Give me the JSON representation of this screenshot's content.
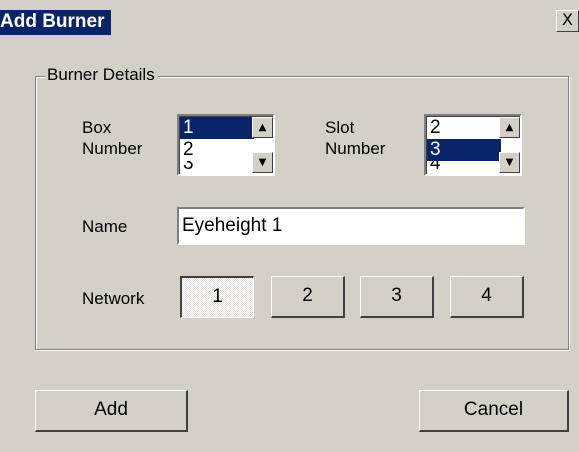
{
  "window": {
    "title": "Add Burner",
    "close_label": "X"
  },
  "group": {
    "label": "Burner Details"
  },
  "box_number": {
    "label_line1": "Box",
    "label_line2": "Number",
    "items": [
      "1",
      "2"
    ],
    "selected": "1"
  },
  "slot_number": {
    "label_line1": "Slot",
    "label_line2": "Number",
    "items": [
      "2",
      "3"
    ],
    "selected": "3"
  },
  "name": {
    "label": "Name",
    "value": "Eyeheight 1"
  },
  "network": {
    "label": "Network",
    "buttons": [
      "1",
      "2",
      "3",
      "4"
    ],
    "selected": "1"
  },
  "actions": {
    "add_label": "Add",
    "cancel_label": "Cancel"
  },
  "icons": {
    "up": "arrow-up-icon",
    "down": "arrow-down-icon"
  },
  "colors": {
    "face": "#d4d0c8",
    "selection": "#0a246a"
  }
}
